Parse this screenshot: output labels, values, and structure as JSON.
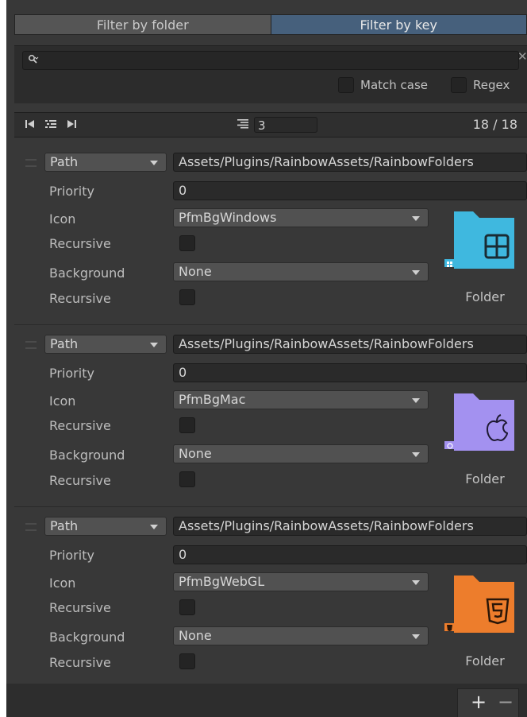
{
  "tabs": [
    {
      "label": "Filter by folder",
      "active": false
    },
    {
      "label": "Filter by key",
      "active": true
    }
  ],
  "search": {
    "value": "",
    "clear_icon": "close-icon"
  },
  "options": {
    "match_case_label": "Match case",
    "regex_label": "Regex",
    "match_case_checked": false,
    "regex_checked": false
  },
  "toolbar": {
    "page_size": "3",
    "counter": "18 / 18"
  },
  "entries": [
    {
      "type": "Path",
      "path": "Assets/Plugins/RainbowAssets/RainbowFolders",
      "priority_label": "Priority",
      "priority": "0",
      "icon_label": "Icon",
      "icon": "PfmBgWindows",
      "recursive_label": "Recursive",
      "background_label": "Background",
      "background": "None",
      "recursive2_label": "Recursive",
      "folder_caption": "Folder",
      "folder_color": "#3fb8df",
      "badge": "windows-logo"
    },
    {
      "type": "Path",
      "path": "Assets/Plugins/RainbowAssets/RainbowFolders",
      "priority_label": "Priority",
      "priority": "0",
      "icon_label": "Icon",
      "icon": "PfmBgMac",
      "recursive_label": "Recursive",
      "background_label": "Background",
      "background": "None",
      "recursive2_label": "Recursive",
      "folder_caption": "Folder",
      "folder_color": "#a391f0",
      "badge": "apple-logo"
    },
    {
      "type": "Path",
      "path": "Assets/Plugins/RainbowAssets/RainbowFolders",
      "priority_label": "Priority",
      "priority": "0",
      "icon_label": "Icon",
      "icon": "PfmBgWebGL",
      "recursive_label": "Recursive",
      "background_label": "Background",
      "background": "None",
      "recursive2_label": "Recursive",
      "folder_caption": "Folder",
      "folder_color": "#ed7d2c",
      "badge": "html5-logo"
    }
  ],
  "footer": {
    "add_label": "+",
    "remove_label": "−"
  }
}
